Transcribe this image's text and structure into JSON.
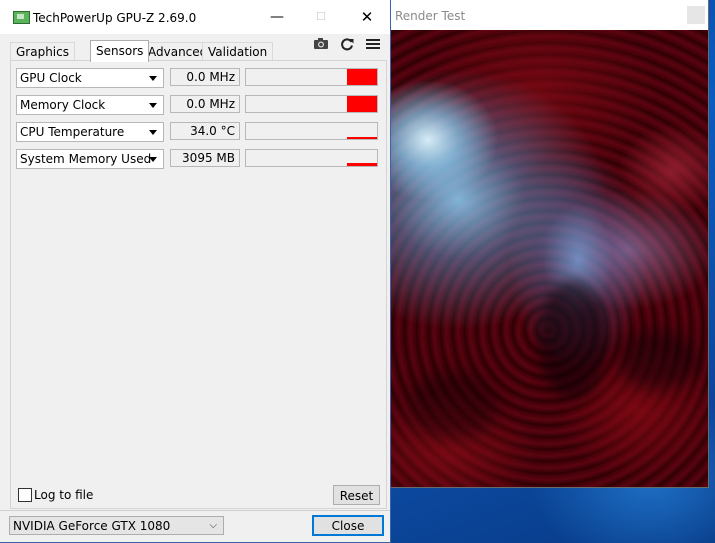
{
  "render_test": {
    "title": "Render Test"
  },
  "gpuz": {
    "title": "TechPowerUp GPU-Z 2.69.0",
    "controls": {
      "minimize": "—",
      "maximize": "☐",
      "close": "✕"
    },
    "tabs": [
      {
        "label": "Graphics Card",
        "active": false
      },
      {
        "label": "Sensors",
        "active": true
      },
      {
        "label": "Advanced",
        "active": false
      },
      {
        "label": "Validation",
        "active": false
      }
    ],
    "toolbar": {
      "camera_icon": "camera-icon",
      "refresh_icon": "refresh-icon",
      "menu_icon": "hamburger-menu-icon"
    },
    "sensors": [
      {
        "name": "GPU Clock",
        "value": "0.0 MHz",
        "graph_level": 1.0
      },
      {
        "name": "Memory Clock",
        "value": "0.0 MHz",
        "graph_level": 1.0
      },
      {
        "name": "CPU Temperature",
        "value": "34.0 °C",
        "graph_level": 0.15
      },
      {
        "name": "System Memory Used",
        "value": "3095 MB",
        "graph_level": 0.2
      }
    ],
    "log_to_file": {
      "label": "Log to file",
      "checked": false
    },
    "reset_label": "Reset",
    "gpu_select": "NVIDIA GeForce GTX 1080",
    "close_label": "Close",
    "colors": {
      "graph": "#ff0000",
      "accent": "#0078d7"
    }
  }
}
